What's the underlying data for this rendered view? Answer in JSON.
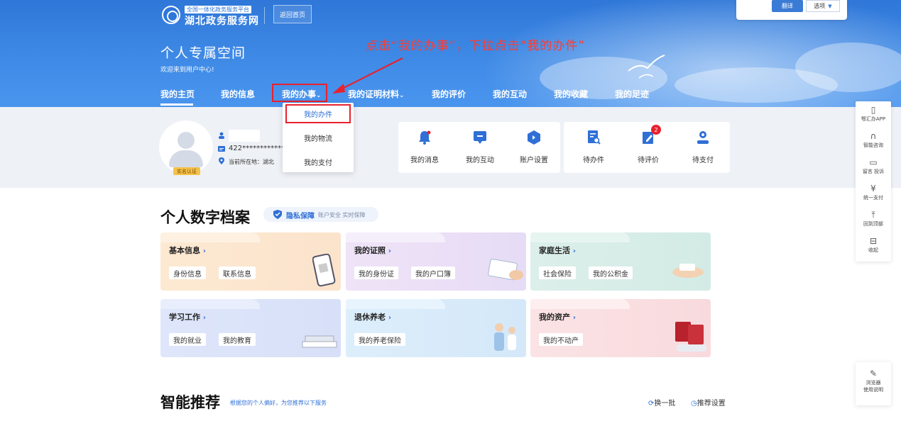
{
  "header": {
    "logo_subtitle": "全国一体化政务服务平台",
    "logo_title": "湖北政务服务网",
    "back_home": "返回首页",
    "space_title": "个人专属空间",
    "welcome": "欢迎来到用户中心!",
    "annotation": "点击“我的办事”，下拉点击“我的办件”"
  },
  "translate": {
    "button": "翻译",
    "option": "选项"
  },
  "nav": {
    "items": [
      "我的主页",
      "我的信息",
      "我的办事",
      "我的证明材料",
      "我的评价",
      "我的互动",
      "我的收藏",
      "我的足迹"
    ],
    "dropdown": [
      "我的办件",
      "我的物流",
      "我的支付"
    ]
  },
  "user": {
    "auth_badge": "实名认证",
    "id_number": "422**************",
    "location": "当前所在地：湖北"
  },
  "quick_links": [
    {
      "label": "我的消息",
      "icon": "bell-icon"
    },
    {
      "label": "我的互动",
      "icon": "chat-icon"
    },
    {
      "label": "账户设置",
      "icon": "settings-icon"
    },
    {
      "label": "待办件",
      "icon": "document-search-icon"
    },
    {
      "label": "待评价",
      "icon": "edit-icon",
      "badge": "2"
    },
    {
      "label": "待支付",
      "icon": "user-pay-icon"
    }
  ],
  "archive": {
    "title": "个人数字档案",
    "privacy_title": "隐私保障",
    "privacy_sub": "账户安全 实时保障",
    "cards": [
      {
        "title": "基本信息",
        "chips": [
          "身份信息",
          "联系信息"
        ]
      },
      {
        "title": "我的证照",
        "chips": [
          "我的身份证",
          "我的户口簿"
        ]
      },
      {
        "title": "家庭生活",
        "chips": [
          "社会保险",
          "我的公积金"
        ]
      },
      {
        "title": "学习工作",
        "chips": [
          "我的就业",
          "我的教育"
        ]
      },
      {
        "title": "退休养老",
        "chips": [
          "我的养老保险"
        ]
      },
      {
        "title": "我的资产",
        "chips": [
          "我的不动产"
        ]
      }
    ]
  },
  "recommend": {
    "title": "智能推荐",
    "subtitle": "根据您的个人偏好，为您推荐以下服务",
    "refresh": "换一批",
    "settings": "推荐设置"
  },
  "sidebar": {
    "items": [
      "鄂汇办APP",
      "智能咨询",
      "留言 投诉",
      "统一支付",
      "回到顶部",
      "收起"
    ],
    "browser_line1": "浏览器",
    "browser_line2": "使用说明"
  },
  "colors": {
    "primary": "#2f6fd6",
    "highlight_red": "#e8212e"
  }
}
